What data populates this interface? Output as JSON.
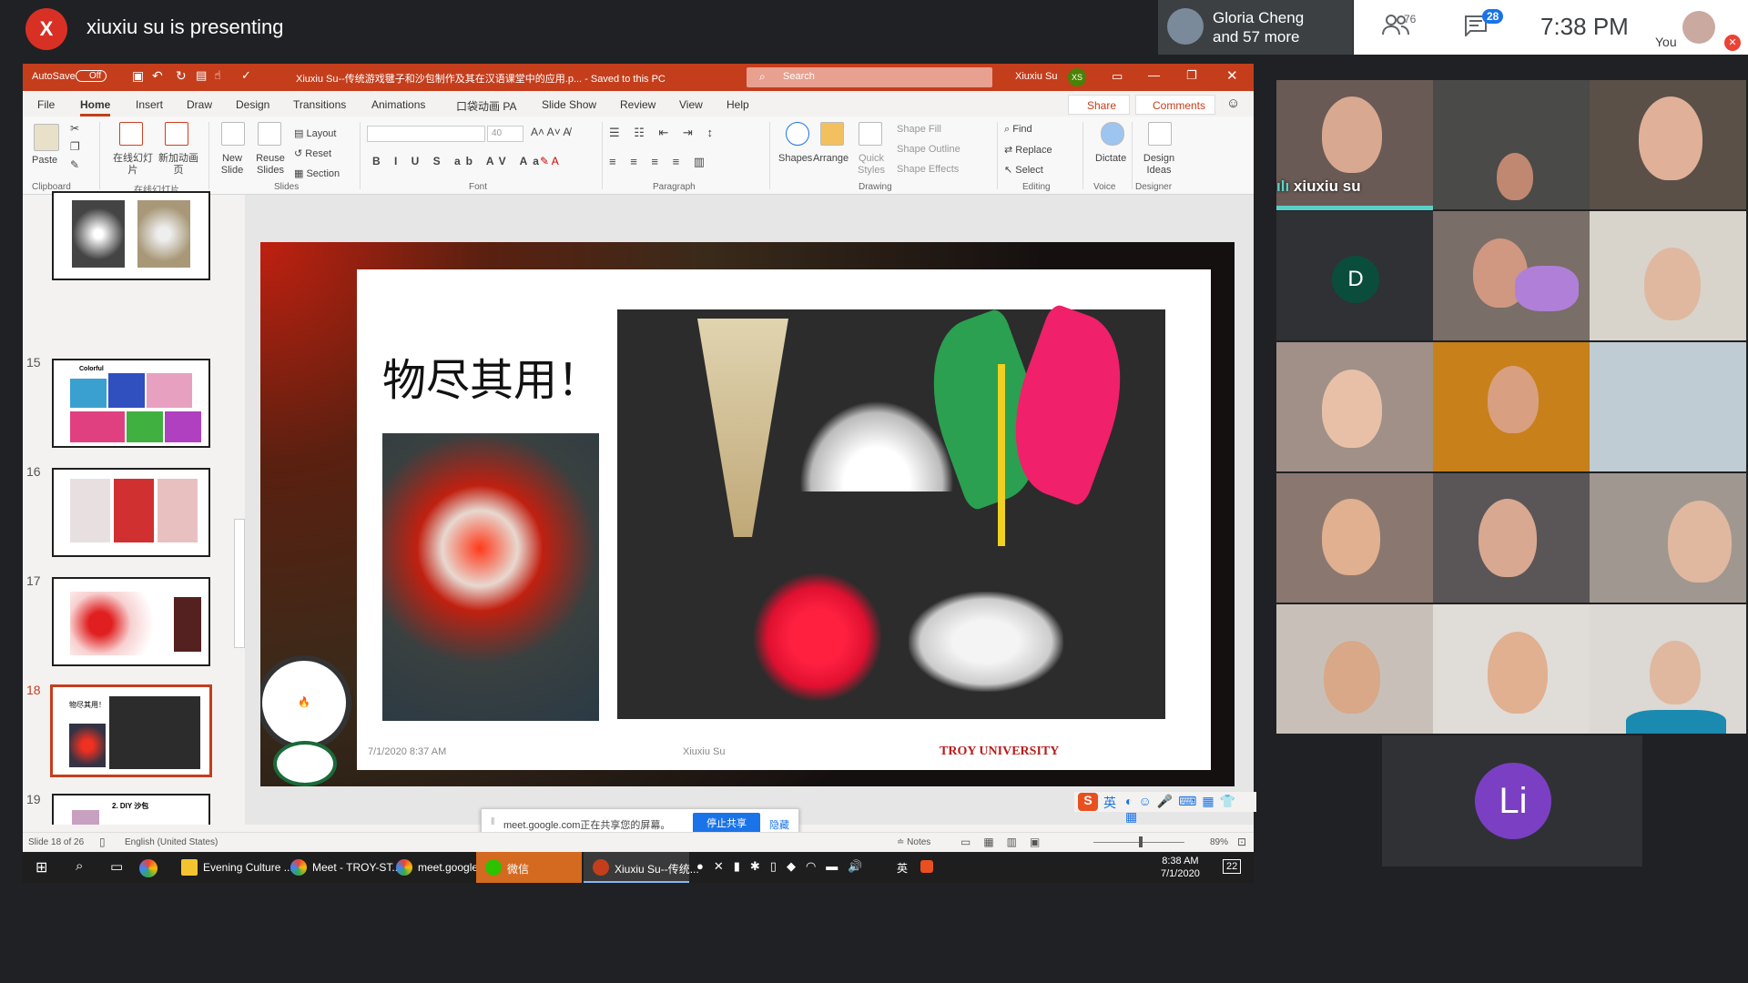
{
  "meet": {
    "presenter_initial": "X",
    "presenter_text": "xiuxiu su is presenting",
    "presenter_color": "#d93025",
    "participant_top": "Gloria Cheng",
    "participant_more": "and 57 more",
    "people_count": "76",
    "chat_count": "28",
    "clock": "7:38 PM",
    "you_label": "You",
    "icons": {
      "people": "people-icon",
      "chat": "chat-icon",
      "mic_off": "mic-off-icon"
    }
  },
  "ppt": {
    "autosave": "AutoSave",
    "autosave_state": "Off",
    "title": "Xiuxiu Su--传统游戏毽子和沙包制作及其在汉语课堂中的应用.p... - Saved to this PC",
    "search_placeholder": "Search",
    "user_name": "Xiuxiu Su",
    "user_initials": "XS",
    "menu": [
      "File",
      "Home",
      "Insert",
      "Draw",
      "Design",
      "Transitions",
      "Animations",
      "口袋动画 PA",
      "Slide Show",
      "Review",
      "View",
      "Help"
    ],
    "share": "Share",
    "comments": "Comments",
    "ribbon": {
      "paste": "Paste",
      "zaixian": "在线幻灯片",
      "xinzeng": "新加动画页",
      "new_slide": "New Slide",
      "reuse_slides": "Reuse Slides",
      "layout": "Layout",
      "reset": "Reset",
      "section": "Section",
      "font_size": "40",
      "shapes": "Shapes",
      "arrange": "Arrange",
      "quick_styles": "Quick Styles",
      "shape_fill": "Shape Fill",
      "shape_outline": "Shape Outline",
      "shape_effects": "Shape Effects",
      "find": "Find",
      "replace": "Replace",
      "select": "Select",
      "dictate": "Dictate",
      "design_ideas": "Design Ideas",
      "groups": [
        "Clipboard",
        "在线幻灯片",
        "Slides",
        "Font",
        "Paragraph",
        "Drawing",
        "Editing",
        "Voice",
        "Designer"
      ]
    },
    "thumbs": [
      {
        "num": ""
      },
      {
        "num": "15",
        "caption": "Colorful"
      },
      {
        "num": "16"
      },
      {
        "num": "17"
      },
      {
        "num": "18",
        "caption": "物尽其用！"
      },
      {
        "num": "19",
        "caption": "2. DIY 沙包"
      }
    ],
    "slide": {
      "title": "物尽其用！",
      "date": "7/1/2020 8:37 AM",
      "author": "Xiuxiu Su",
      "org": "TROY UNIVERSITY"
    },
    "share_bar": {
      "text": "meet.google.com正在共享您的屏幕。",
      "stop": "停止共享",
      "hide": "隐藏"
    },
    "status": {
      "slide_of": "Slide 18 of 26",
      "language": "English (United States)",
      "notes": "Notes",
      "zoom": "89%"
    },
    "ime": "英"
  },
  "taskbar": {
    "items": [
      "Evening Culture ...",
      "Meet - TROY-ST...",
      "meet.google.co...",
      "微信",
      "Xiuxiu Su--传统..."
    ],
    "tray_lang": "英",
    "time": "8:38 AM",
    "date": "7/1/2020",
    "notif": "22"
  },
  "grid": {
    "speaking_name": "xiuxiu su",
    "avatar_d": "D",
    "avatar_li": "Li",
    "avatar_d_color": "#0b4d3c",
    "avatar_li_color": "#7b3fc4"
  }
}
